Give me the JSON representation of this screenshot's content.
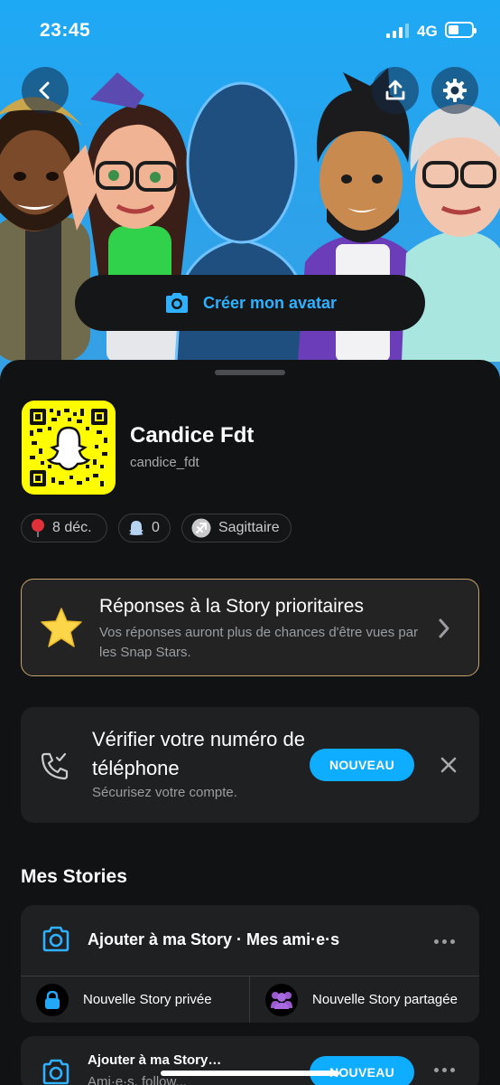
{
  "status_bar": {
    "time": "23:45",
    "network": "4G"
  },
  "hero": {
    "create_avatar_label": "Créer mon avatar"
  },
  "profile": {
    "display_name": "Candice Fdt",
    "username": "candice_fdt",
    "chips": [
      {
        "icon": "balloon-icon",
        "label": "8 déc."
      },
      {
        "icon": "ghost-icon",
        "label": "0"
      },
      {
        "icon": "sagittarius-icon",
        "label": "Sagittaire"
      }
    ]
  },
  "priority_card": {
    "title": "Réponses à la Story prioritaires",
    "description": "Vos réponses auront plus de chances d'être vues par les Snap Stars."
  },
  "phone_card": {
    "title": "Vérifier votre numéro de téléphone",
    "description": "Sécurisez votre compte.",
    "badge": "NOUVEAU"
  },
  "stories": {
    "section_title": "Mes Stories",
    "add_story_label": "Ajouter à ma Story · Mes ami·e·s",
    "private_story_label": "Nouvelle Story privée",
    "shared_story_label": "Nouvelle Story partagée",
    "second_card": {
      "title": "Ajouter à ma Story…",
      "subtitle": "Ami·e·s, follow...",
      "badge": "NOUVEAU"
    }
  },
  "colors": {
    "accent_blue": "#0fadff",
    "snap_yellow": "#fffc00",
    "sheet_bg": "#111214",
    "card_bg": "#1f2022",
    "gold_border": "#c8a36a"
  }
}
